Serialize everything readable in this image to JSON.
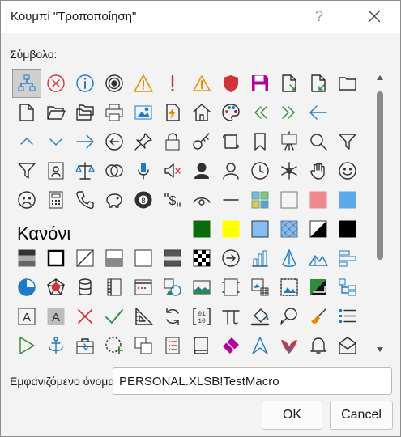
{
  "dialog": {
    "title": "Κουμπί \"Τροποποίηση\"",
    "help_glyph": "?",
    "symbol_label": "Σύμβολο:",
    "style_heading": "Κανόνι",
    "display_name_label": "Εμφανιζόμενο όνομα:",
    "display_name_value": "PERSONAL.XLSB!TestMacro",
    "ok_label": "OK",
    "cancel_label": "Cancel"
  },
  "colors": {
    "accent_blue": "#1e7bc8",
    "red": "#d13438",
    "orange": "#e88a00",
    "green": "#2e8b3a",
    "purple": "#b4009e",
    "gray_icon": "#303030"
  },
  "icons": [
    [
      "org-chart",
      "no-entry",
      "info",
      "target",
      "warning",
      "exclamation",
      "warning-small",
      "shield",
      "floppy-disk",
      "doc-arrow",
      "doc-arrow-green",
      "folder"
    ],
    [
      "page",
      "folder-open",
      "folders",
      "printer",
      "picture",
      "lightning-doc",
      "home",
      "palette",
      "double-left",
      "double-right",
      "arrow-left",
      ""
    ],
    [
      "chevron-up",
      "chevron-down",
      "arrow-right",
      "circle-left",
      "pin",
      "lock",
      "key",
      "scroll",
      "bookmark",
      "easel",
      "search",
      "funnel"
    ],
    [
      "funnel-lines",
      "contact-card",
      "scales",
      "circles",
      "microphone",
      "mute",
      "person-filled",
      "person",
      "clock",
      "snowflake",
      "hand",
      "smiley"
    ],
    [
      "frown",
      "calculator",
      "phone",
      "piggy-bank",
      "eight-ball",
      "dollar-quotes",
      "eye",
      "dash",
      "color-grid",
      "square-gray",
      "square-red",
      "square-blue"
    ],
    [
      "",
      "",
      "",
      "",
      "",
      "",
      "square-green",
      "square-yellow",
      "square-blue-light",
      "square-hatched",
      "half-square",
      "square-black"
    ],
    [
      "bars-gray",
      "square-outline",
      "diagonal-square",
      "split-square",
      "square-white",
      "square-stripes",
      "checker",
      "circle-arrow",
      "bar-chart",
      "cone",
      "mountains",
      "bars-right"
    ],
    [
      "pie-chart",
      "radar",
      "cylinders",
      "doc-binder",
      "app-window",
      "3d-shapes",
      "landscape",
      "frame",
      "image-grid",
      "image-dotted",
      "gradient-square",
      "hierarchy"
    ],
    [
      "letter-a",
      "letter-a-gray",
      "cross-x",
      "check",
      "triangle-ruler",
      "refresh",
      "binary-box",
      "pi",
      "pour",
      "lasso",
      "brush",
      "list-bullets"
    ],
    [
      "play",
      "anchor",
      "toolbox",
      "dotted-plus",
      "copy-stack",
      "red-list",
      "book",
      "eraser",
      "arrow-up-right",
      "bird",
      "bell",
      "envelope"
    ]
  ]
}
